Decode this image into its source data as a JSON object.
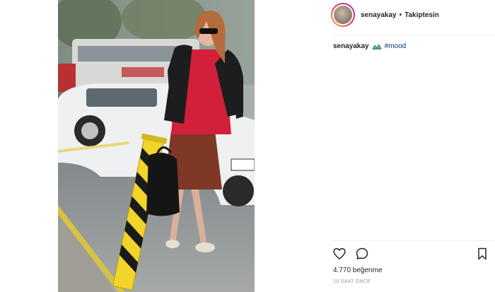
{
  "post": {
    "username": "senayakay",
    "separator": "•",
    "follow_status": "Takiptesin",
    "caption_username": "senayakay",
    "caption_hashtag": "#mood",
    "likes_text": "4.770 beğenme",
    "timestamp": "20 SAAT ÖNCE"
  },
  "icons": {
    "mood_emoji": "mood-emoji-icon",
    "like": "heart-icon",
    "comment": "comment-icon",
    "save": "bookmark-icon"
  },
  "colors": {
    "text": "#262626",
    "hashtag": "#003569",
    "muted": "#999999",
    "divider": "#efefef",
    "jacket": "#1d1d1f",
    "hoodie": "#d3203a",
    "bollard_yellow": "#f2d42a"
  }
}
